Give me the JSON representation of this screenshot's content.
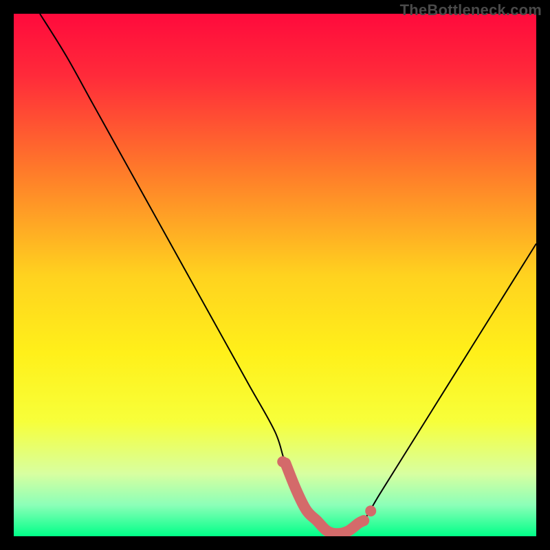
{
  "watermark": "TheBottleneck.com",
  "chart_data": {
    "type": "line",
    "title": "",
    "xlabel": "",
    "ylabel": "",
    "xlim": [
      0,
      100
    ],
    "ylim": [
      0,
      100
    ],
    "series": [
      {
        "name": "bottleneck-curve",
        "x": [
          5,
          10,
          15,
          20,
          25,
          30,
          35,
          40,
          45,
          50,
          52,
          55,
          58,
          60,
          62,
          65,
          67,
          70,
          75,
          80,
          85,
          90,
          95,
          100
        ],
        "y": [
          100,
          92,
          83,
          74,
          65,
          56,
          47,
          38,
          29,
          20,
          14,
          8,
          3,
          1,
          0.5,
          1,
          3,
          8,
          16,
          24,
          32,
          40,
          48,
          56
        ]
      }
    ],
    "highlight": {
      "name": "bottleneck-range-marker",
      "color": "#d46a6a",
      "x": [
        52,
        54,
        56,
        58,
        60,
        62,
        64,
        66,
        67
      ],
      "y": [
        14,
        9,
        5,
        3,
        1,
        0.5,
        1,
        2.5,
        3
      ]
    },
    "gradient_stops": [
      {
        "pos": 0.0,
        "color": "#ff0a3c"
      },
      {
        "pos": 0.12,
        "color": "#ff2b3a"
      },
      {
        "pos": 0.3,
        "color": "#ff7a2a"
      },
      {
        "pos": 0.5,
        "color": "#ffd21f"
      },
      {
        "pos": 0.65,
        "color": "#fff01a"
      },
      {
        "pos": 0.78,
        "color": "#f7ff3a"
      },
      {
        "pos": 0.88,
        "color": "#d8ffa0"
      },
      {
        "pos": 0.94,
        "color": "#8cffb8"
      },
      {
        "pos": 1.0,
        "color": "#00ff88"
      }
    ]
  }
}
